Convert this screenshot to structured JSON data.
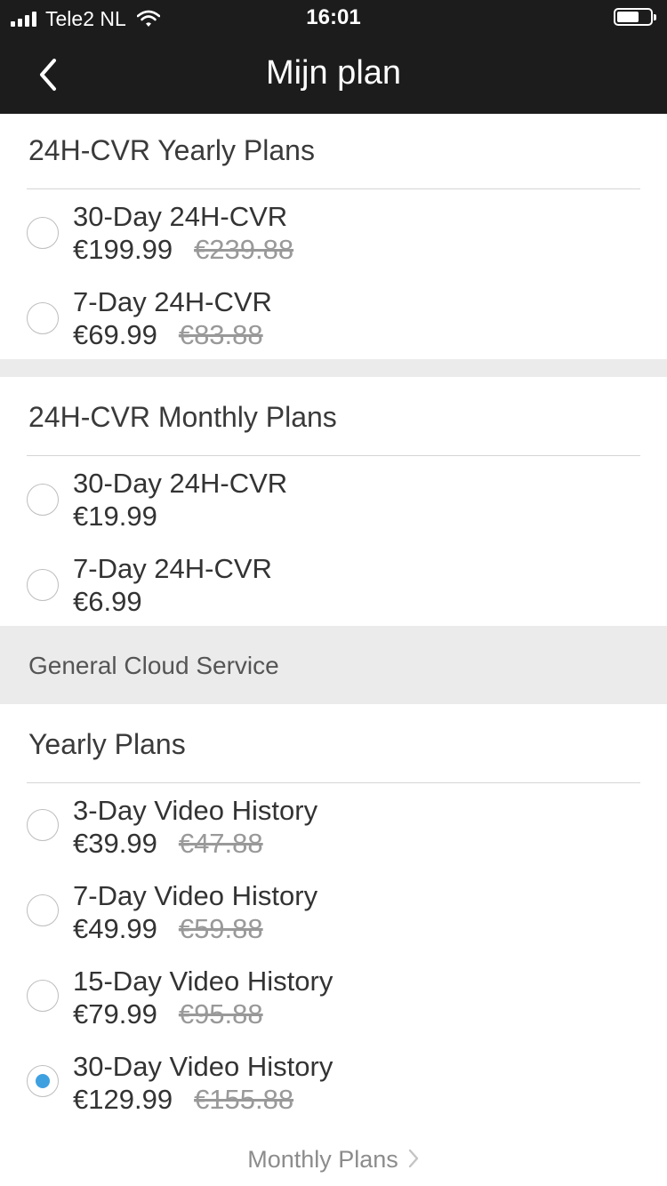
{
  "status_bar": {
    "carrier": "Tele2 NL",
    "time": "16:01",
    "signal_icon": "signal-bars-icon",
    "wifi_icon": "wifi-icon",
    "battery_icon": "battery-icon",
    "battery_level": 0.55
  },
  "nav": {
    "title": "Mijn plan",
    "back_icon": "chevron-left-icon"
  },
  "sections": {
    "cvr_yearly": {
      "header": "24H-CVR Yearly Plans",
      "items": [
        {
          "name": "30-Day 24H-CVR",
          "price": "€199.99",
          "old_price": "€239.88",
          "selected": false
        },
        {
          "name": "7-Day 24H-CVR",
          "price": "€69.99",
          "old_price": "€83.88",
          "selected": false
        }
      ]
    },
    "cvr_monthly": {
      "header": "24H-CVR Monthly Plans",
      "items": [
        {
          "name": "30-Day 24H-CVR",
          "price": "€19.99",
          "selected": false
        },
        {
          "name": "7-Day 24H-CVR",
          "price": "€6.99",
          "selected": false
        }
      ]
    },
    "general_cloud": {
      "band_label": "General Cloud Service",
      "header": "Yearly Plans",
      "items": [
        {
          "name": "3-Day Video History",
          "price": "€39.99",
          "old_price": "€47.88",
          "selected": false
        },
        {
          "name": "7-Day Video History",
          "price": "€49.99",
          "old_price": "€59.88",
          "selected": false
        },
        {
          "name": "15-Day Video History",
          "price": "€79.99",
          "old_price": "€95.88",
          "selected": false
        },
        {
          "name": "30-Day Video History",
          "price": "€129.99",
          "old_price": "€155.88",
          "selected": true
        }
      ]
    }
  },
  "footer": {
    "link_label": "Monthly Plans",
    "link_icon": "chevron-right-icon"
  },
  "colors": {
    "nav_background": "#1c1c1c",
    "selected_radio": "#3fa0e0",
    "band_background": "#ebebeb"
  }
}
